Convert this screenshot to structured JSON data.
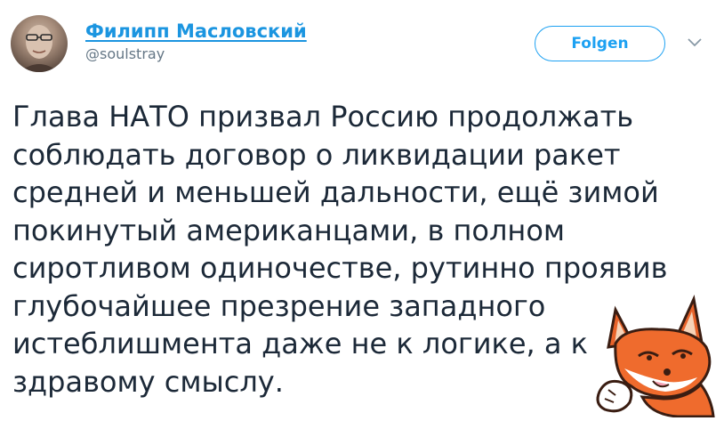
{
  "author": {
    "name": "Филипп Масловский",
    "handle": "@soulstray"
  },
  "actions": {
    "follow_label": "Folgen",
    "menu_icon": "chevron-down-icon"
  },
  "tweet": {
    "lines": [
      "Глава НАТО призвал Россию продолжать",
      "соблюдать договор о ликвидации ракет",
      "средней и меньшей дальности, ещё зимой",
      "покинутый американцами, в полном",
      "сиротливом одиночестве, рутинно проявив",
      "глубочайшее презрение западного",
      "истеблишмента даже не к логике, а к",
      "здравому смыслу."
    ]
  },
  "colors": {
    "link": "#1b95e0",
    "accent": "#1da1f2",
    "text": "#1c2938",
    "muted": "#657786"
  }
}
